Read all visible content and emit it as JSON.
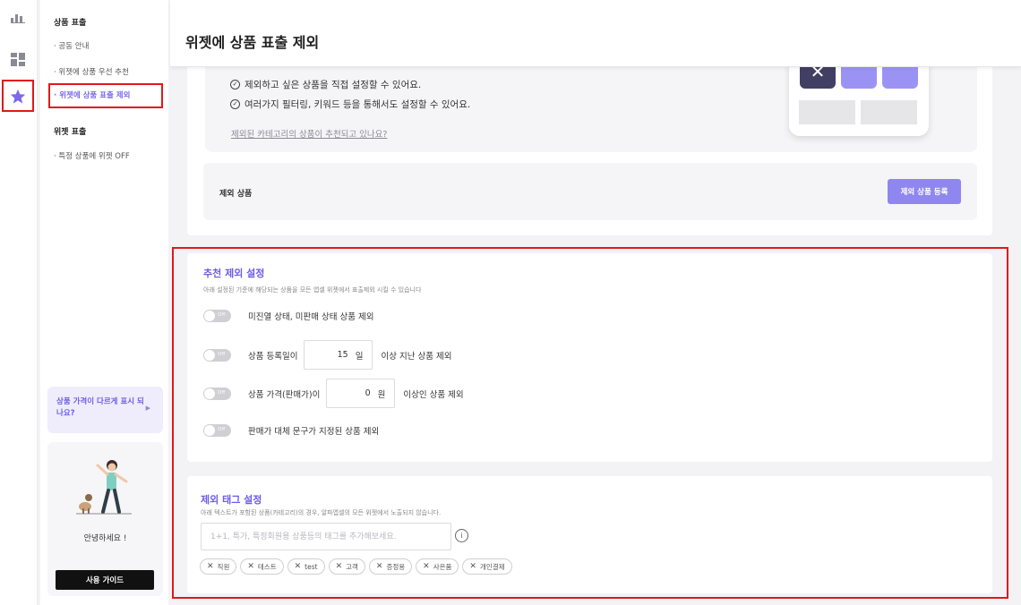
{
  "page": {
    "title": "위젯에 상품 표출 제외"
  },
  "sidebar": {
    "sections": [
      {
        "title": "상품 표출",
        "items": [
          "· 공동 안내",
          "· 위젯에 상품 우선 추천",
          "· 위젯에 상품 표출 제외"
        ]
      },
      {
        "title": "위젯 표출",
        "items": [
          "· 특정 상품에 위젯 OFF"
        ]
      }
    ],
    "active_item": "· 위젯에 상품 표출 제외",
    "promo": {
      "text": "상품 가격이 다르게 표시 되나요?"
    },
    "guide": {
      "greeting": "안녕하세요 !",
      "button": "사용 가이드"
    }
  },
  "rail": {
    "icons": [
      "bar-chart-icon",
      "dashboard-icon",
      "star-icon"
    ],
    "active": "star-icon"
  },
  "info": {
    "lines": [
      "제외하고 싶은 상품을 직접 설정할 수 있어요.",
      "여러가지 필터링, 키워드 등을 통해서도 설정할 수 있어요."
    ],
    "link": "제외된 카테고리의 상품이 추천되고 있나요?"
  },
  "excluded": {
    "label": "제외 상품",
    "button": "제외 상품 등록"
  },
  "recommend": {
    "title": "추천 제외 설정",
    "description": "아래 설정된 기준에 해당되는 상품을 모든 앱셀 위젯에서 표출제외 시킬 수 있습니다",
    "toggle_label": "Off",
    "options": [
      {
        "text": "미진열 상태, 미판매 상태 상품 제외"
      },
      {
        "prefix": "상품 등록일이",
        "value": "15",
        "unit": "일",
        "suffix": "이상 지난 상품 제외"
      },
      {
        "prefix": "상품 가격(판매가)이",
        "value": "0",
        "unit": "원",
        "suffix": "이상인 상품 제외"
      },
      {
        "text": "판매가 대체 문구가 지정된 상품 제외"
      }
    ]
  },
  "tags": {
    "title": "제외 태그 설정",
    "description": "아래 텍스트가 포함된 상품(카테고리)의 경우, 알파앱셀의 모든 위젯에서 노출되지 않습니다.",
    "placeholder": "1+1, 특가, 특정회원용 상품등의 태그를 추가해보세요.",
    "chips": [
      "직원",
      "테스트",
      "test",
      "고객",
      "증정용",
      "사은품",
      "개인결제"
    ]
  },
  "colors": {
    "accent": "#7b68ee",
    "highlight": "#e01919"
  }
}
